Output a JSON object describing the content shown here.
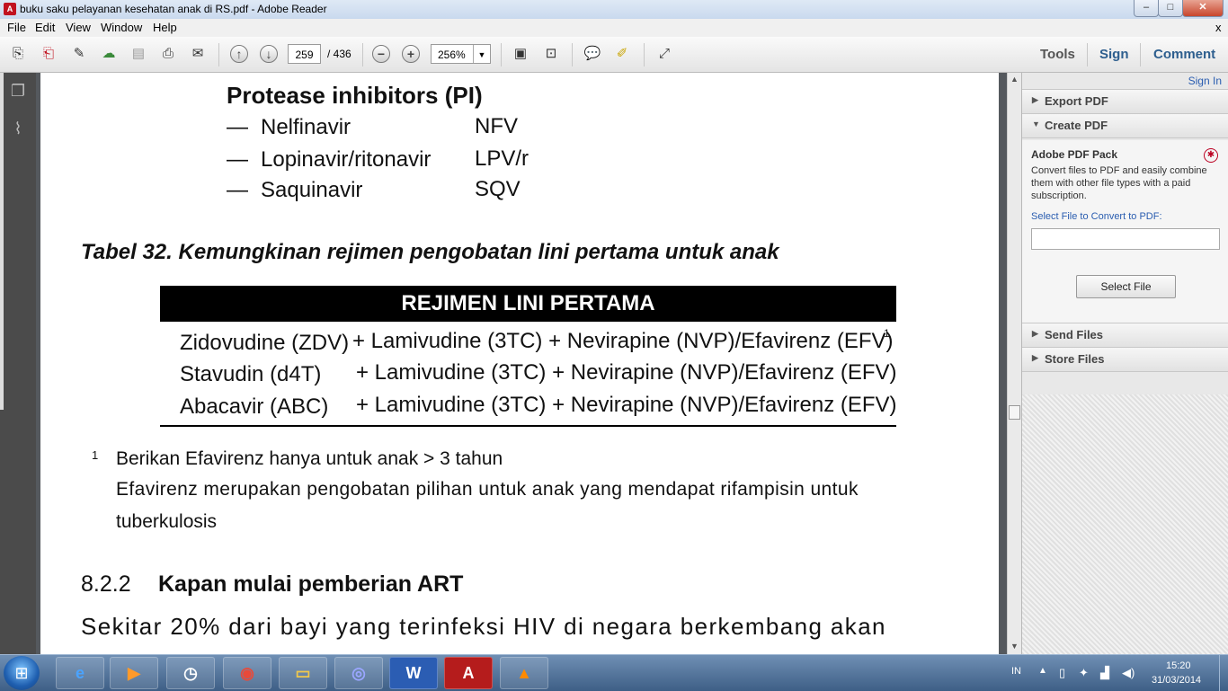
{
  "window": {
    "title": "buku saku pelayanan kesehatan anak di RS.pdf - Adobe Reader",
    "controls": {
      "minimize": "–",
      "maximize": "□",
      "close": "✕"
    }
  },
  "menu": {
    "items": [
      "File",
      "Edit",
      "View",
      "Window",
      "Help"
    ],
    "close_doc": "x"
  },
  "toolbar": {
    "page_current": "259",
    "page_total": "/ 436",
    "zoom_value": "256%",
    "tools_label": "Tools",
    "sign_label": "Sign",
    "comment_label": "Comment"
  },
  "document": {
    "pi_heading": "Protease inhibitors (PI)",
    "drugs": [
      {
        "dash": "—",
        "name": "Nelfinavir",
        "abbr": "NFV"
      },
      {
        "dash": "—",
        "name": "Lopinavir/ritonavir",
        "abbr": "LPV/r"
      },
      {
        "dash": "—",
        "name": "Saquinavir",
        "abbr": "SQV"
      }
    ],
    "table_caption": "Tabel 32. Kemungkinan rejimen pengobatan lini pertama untuk anak",
    "table_header": "REJIMEN LINI PERTAMA",
    "table_rows": [
      {
        "first": "Zidovudine (ZDV)",
        "rest": "+ Lamivudine (3TC) + Nevirapine (NVP)/Efavirenz (EFV)",
        "sup": "1"
      },
      {
        "first": "Stavudin (d4T)",
        "rest": "+ Lamivudine (3TC) + Nevirapine (NVP)/Efavirenz (EFV)",
        "sup": ""
      },
      {
        "first": "Abacavir (ABC)",
        "rest": "+ Lamivudine (3TC) + Nevirapine (NVP)/Efavirenz (EFV)",
        "sup": ""
      }
    ],
    "footnote_marker": "1",
    "footnote_line1": "Berikan Efavirenz hanya untuk anak > 3 tahun",
    "footnote_line2": "Efavirenz merupakan pengobatan pilihan untuk anak yang mendapat rifampisin untuk",
    "footnote_line3": "tuberkulosis",
    "section_number": "8.2.2",
    "section_title": "Kapan mulai pemberian ART",
    "body_line1": "Sekitar 20% dari bayi yang terinfeksi HIV di negara berkembang akan"
  },
  "right_panel": {
    "sign_in": "Sign In",
    "export_pdf": "Export PDF",
    "create_pdf": "Create PDF",
    "pack_title": "Adobe PDF Pack",
    "pack_description": "Convert files to PDF and easily combine them with other file types with a paid subscription.",
    "select_label": "Select File to Convert to PDF:",
    "select_button": "Select File",
    "send_files": "Send Files",
    "store_files": "Store Files"
  },
  "taskbar": {
    "language": "IN",
    "time": "15:20",
    "date": "31/03/2014",
    "apps": [
      "internet-explorer",
      "media-player",
      "clock",
      "chrome",
      "file-explorer",
      "media-app",
      "word",
      "adobe-reader",
      "vlc"
    ]
  },
  "colors": {
    "accent_blue": "#2a5db0",
    "adobe_red": "#c1121f",
    "table_header_bg": "#000000"
  }
}
